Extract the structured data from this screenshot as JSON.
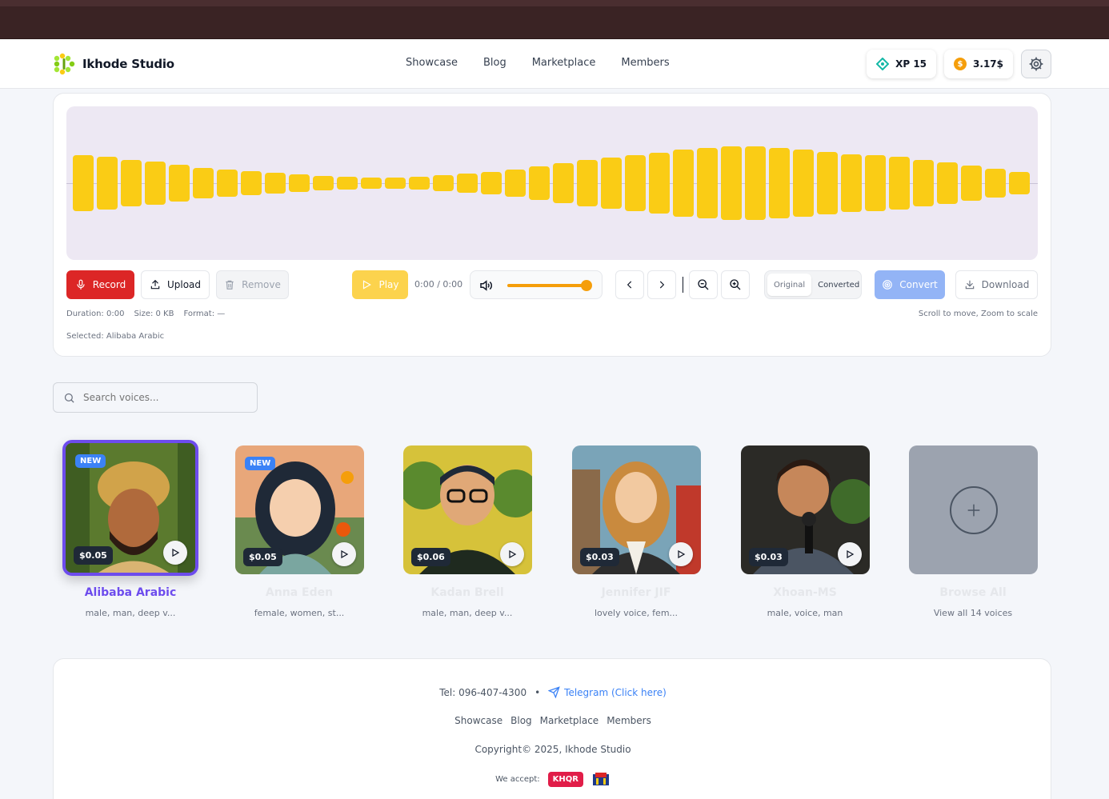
{
  "app": {
    "name": "Ikhode Studio"
  },
  "nav": {
    "items": [
      "Showcase",
      "Blog",
      "Marketplace",
      "Members"
    ]
  },
  "header": {
    "xp_label": "XP 15",
    "balance": "3.17$",
    "coin_symbol": "$"
  },
  "waveform": {
    "bar_heights": [
      0.36,
      0.34,
      0.3,
      0.28,
      0.24,
      0.2,
      0.18,
      0.16,
      0.14,
      0.11,
      0.09,
      0.08,
      0.07,
      0.07,
      0.08,
      0.1,
      0.12,
      0.15,
      0.18,
      0.22,
      0.26,
      0.3,
      0.33,
      0.36,
      0.4,
      0.44,
      0.46,
      0.48,
      0.48,
      0.46,
      0.44,
      0.41,
      0.38,
      0.36,
      0.34,
      0.3,
      0.27,
      0.23,
      0.19,
      0.15
    ],
    "color": "#facc15"
  },
  "controls": {
    "record": "Record",
    "upload": "Upload",
    "remove": "Remove",
    "play": "Play",
    "time": "0:00 / 0:00",
    "volume": 0.95,
    "toggle_original": "Original",
    "toggle_converted": "Converted",
    "convert": "Convert",
    "download": "Download"
  },
  "meta": {
    "duration": "Duration: 0:00",
    "size": "Size: 0 KB",
    "format": "Format: —",
    "hint": "Scroll to move, Zoom to scale",
    "selected": "Selected: Alibaba Arabic"
  },
  "search": {
    "placeholder": "Search voices..."
  },
  "voices": [
    {
      "name": "Alibaba Arabic",
      "tags": "male, man, deep v...",
      "price": "$0.05",
      "badge": "NEW",
      "selected": true
    },
    {
      "name": "Anna Eden",
      "tags": "female, women, st...",
      "price": "$0.05",
      "badge": "NEW",
      "selected": false
    },
    {
      "name": "Kadan Brell",
      "tags": "male, man, deep v...",
      "price": "$0.06",
      "badge": "",
      "selected": false
    },
    {
      "name": "Jennifer JIF",
      "tags": "lovely voice, fem...",
      "price": "$0.03",
      "badge": "",
      "selected": false
    },
    {
      "name": "Xhoan-MS",
      "tags": "male, voice, man",
      "price": "$0.03",
      "badge": "",
      "selected": false
    }
  ],
  "browse": {
    "label": "Browse All",
    "sub": "View all 14 voices"
  },
  "footer": {
    "tel": "Tel: 096-407-4300",
    "dot": "•",
    "telegram": "Telegram (Click here)",
    "links": [
      "Showcase",
      "Blog",
      "Marketplace",
      "Members"
    ],
    "copyright": "Copyright© 2025, Ikhode Studio",
    "we_accept": "We accept:",
    "khqr": "KHQR"
  }
}
